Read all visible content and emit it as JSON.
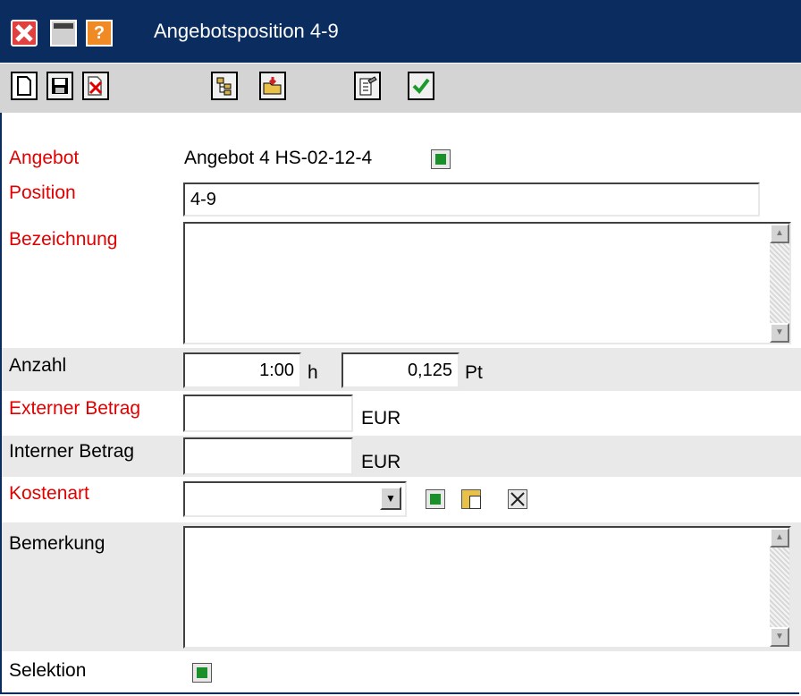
{
  "window": {
    "title": "Angebotsposition 4-9",
    "colors": {
      "titlebar": "#0b2c5e",
      "required_label": "#e00000"
    }
  },
  "toolbar": {
    "icons": [
      "new-document-icon",
      "save-icon",
      "delete-document-icon",
      "tree-icon",
      "open-folder-icon",
      "edit-icon",
      "confirm-check-icon"
    ]
  },
  "form": {
    "angebot": {
      "label": "Angebot",
      "value": "Angebot 4 HS-02-12-4"
    },
    "position": {
      "label": "Position",
      "value": "4-9"
    },
    "bezeichnung": {
      "label": "Bezeichnung",
      "value": ""
    },
    "anzahl": {
      "label": "Anzahl",
      "hours_value": "1:00",
      "hours_unit": "h",
      "points_value": "0,125",
      "points_unit": "Pt"
    },
    "externer_betrag": {
      "label": "Externer Betrag",
      "value": "",
      "unit": "EUR"
    },
    "interner_betrag": {
      "label": "Interner Betrag",
      "value": "",
      "unit": "EUR"
    },
    "kostenart": {
      "label": "Kostenart",
      "value": ""
    },
    "bemerkung": {
      "label": "Bemerkung",
      "value": ""
    },
    "selektion": {
      "label": "Selektion"
    }
  }
}
